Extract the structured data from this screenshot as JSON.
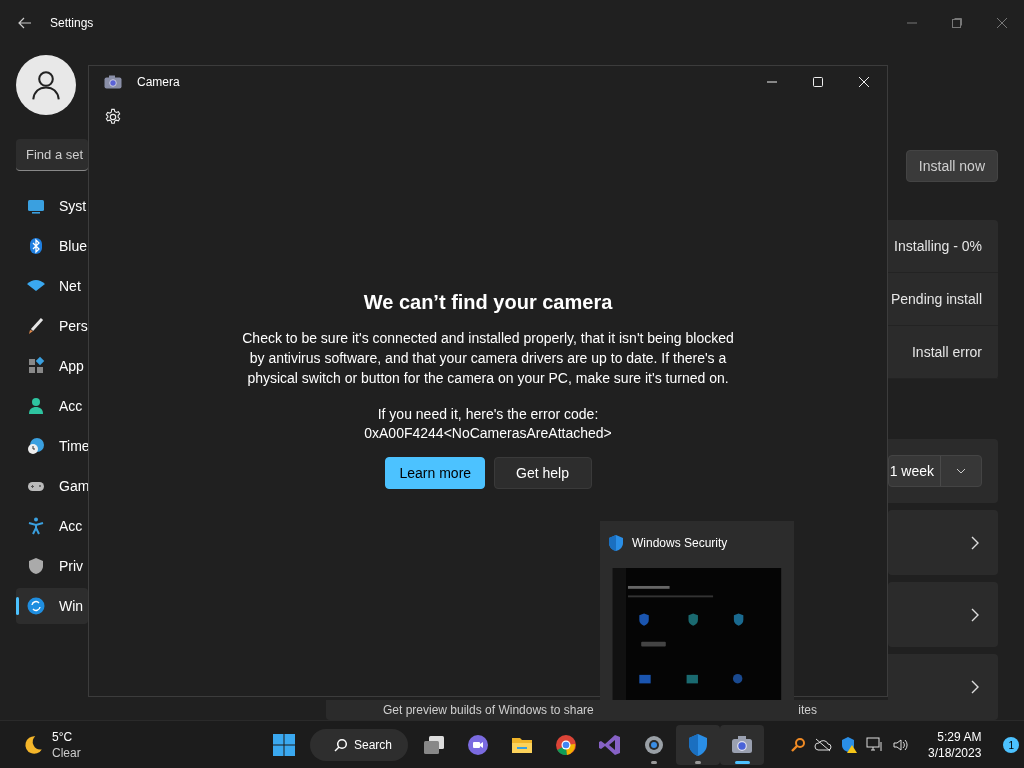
{
  "settings": {
    "title": "Settings",
    "search": {
      "placeholder": "Find a set"
    },
    "sidebar": {
      "items": [
        {
          "label": "Syst",
          "kind": "system",
          "selected": false
        },
        {
          "label": "Blue",
          "kind": "bluetooth",
          "selected": false
        },
        {
          "label": "Net",
          "kind": "network",
          "selected": false
        },
        {
          "label": "Pers",
          "kind": "personalization",
          "selected": false
        },
        {
          "label": "App",
          "kind": "apps",
          "selected": false
        },
        {
          "label": "Acc",
          "kind": "accounts",
          "selected": false
        },
        {
          "label": "Time",
          "kind": "time",
          "selected": false
        },
        {
          "label": "Gam",
          "kind": "gaming",
          "selected": false
        },
        {
          "label": "Acc",
          "kind": "accessibility",
          "selected": false
        },
        {
          "label": "Priv",
          "kind": "privacy",
          "selected": false
        },
        {
          "label": "Win",
          "kind": "update",
          "selected": true
        }
      ]
    },
    "install_button": "Install now",
    "update_statuses": [
      "Installing - 0%",
      "Pending install",
      "Install error"
    ],
    "pause_dropdown": {
      "value": "1 week"
    },
    "insider_card": {
      "description_start": "Get preview builds of Windows to share",
      "description_end": "ites"
    }
  },
  "camera_window": {
    "title": "Camera",
    "heading": "We can’t find your camera",
    "message": "Check to be sure it's connected and installed properly, that it isn't being blocked by antivirus software, and that your camera drivers are up to date. If there's a physical switch or button for the camera on your PC, make sure it's turned on.",
    "error_label": "If you need it, here's the error code:",
    "error_code": "0xA00F4244<NoCamerasAreAttached>",
    "buttons": [
      {
        "label": "Learn more",
        "kind": "primary"
      },
      {
        "label": "Get help",
        "kind": "secondary"
      }
    ]
  },
  "task_preview": {
    "title": "Windows Security"
  },
  "taskbar": {
    "weather": {
      "temperature": "5°C",
      "condition": "Clear"
    },
    "search_label": "Search",
    "apps": [
      {
        "kind": "task-view",
        "running": false,
        "focused": false,
        "highlighted": false
      },
      {
        "kind": "chat",
        "running": false,
        "focused": false,
        "highlighted": false
      },
      {
        "kind": "files",
        "running": false,
        "focused": false,
        "highlighted": false
      },
      {
        "kind": "browser",
        "running": false,
        "focused": false,
        "highlighted": false
      },
      {
        "kind": "studio",
        "running": false,
        "focused": false,
        "highlighted": false
      },
      {
        "kind": "settings",
        "running": true,
        "focused": false,
        "highlighted": false
      },
      {
        "kind": "security",
        "running": true,
        "focused": false,
        "highlighted": true
      },
      {
        "kind": "camera",
        "running": true,
        "focused": true,
        "highlighted": true
      }
    ],
    "time": "5:29 AM",
    "date": "3/18/2023",
    "notification_count": "1"
  }
}
